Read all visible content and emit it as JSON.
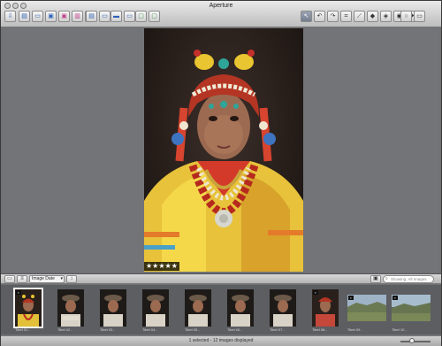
{
  "window": {
    "title": "Aperture"
  },
  "toolbar": {
    "left_icons": [
      "import-icon",
      "new-project-icon",
      "new-folder-icon",
      "new-album-icon",
      "new-smart-album-icon",
      "new-book-icon",
      "new-web-icon",
      "stack-icon",
      "split-icon",
      "browser-icon",
      "viewer-icon",
      "compare-icon",
      "auto-stack-icon"
    ],
    "right_icons": [
      "select-tool-icon",
      "rotate-left-icon",
      "rotate-right-icon",
      "crop-tool-icon",
      "straighten-tool-icon",
      "lift-tool-icon",
      "stamp-tool-icon",
      "red-eye-icon",
      "spot-patch-icon",
      "loupe-icon",
      "hud-icon"
    ]
  },
  "viewer": {
    "rating": "★★★★★"
  },
  "browser": {
    "sort_value": "Image Date",
    "search_placeholder": "Showing: All Images"
  },
  "filmstrip": {
    "thumbs": [
      {
        "label": "Tibet 01 -",
        "selected": true
      },
      {
        "label": "Tibet 02 -",
        "selected": false
      },
      {
        "label": "Tibet 03 -",
        "selected": false
      },
      {
        "label": "Tibet 04 -",
        "selected": false
      },
      {
        "label": "Tibet 05 -",
        "selected": false
      },
      {
        "label": "Tibet 06 -",
        "selected": false
      },
      {
        "label": "Tibet 07 -",
        "selected": false
      },
      {
        "label": "Tibet 08 -",
        "selected": false
      },
      {
        "label": "Tibet 09 -",
        "selected": false
      },
      {
        "label": "Tibet 10 -",
        "selected": false
      }
    ]
  },
  "status": {
    "text": "1 selected - 12 images displayed"
  }
}
